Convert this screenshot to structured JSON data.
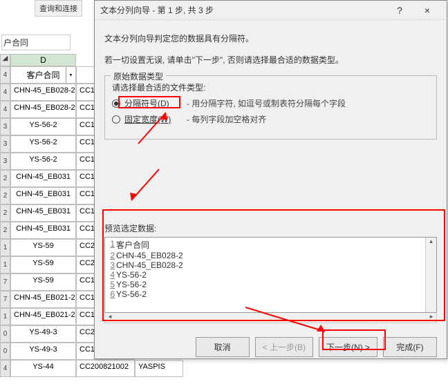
{
  "ribbon_group": "查询和连接",
  "cell_name_box": "户合同",
  "columns": {
    "D": "D"
  },
  "table_header": {
    "D": "客户合同"
  },
  "rows": [
    {
      "r": "4",
      "D": "CHN-45_EB028-2",
      "E": "CC1"
    },
    {
      "r": "4",
      "D": "CHN-45_EB028-2",
      "E": "CC1"
    },
    {
      "r": "3",
      "D": "YS-56-2",
      "E": "CC1"
    },
    {
      "r": "3",
      "D": "YS-56-2",
      "E": "CC1"
    },
    {
      "r": "3",
      "D": "YS-56-2",
      "E": "CC1"
    },
    {
      "r": "2",
      "D": "CHN-45_EB031",
      "E": "CC1"
    },
    {
      "r": "2",
      "D": "CHN-45_EB031",
      "E": "CC1"
    },
    {
      "r": "2",
      "D": "CHN-45_EB031",
      "E": "CC1"
    },
    {
      "r": "2",
      "D": "CHN-45_EB031",
      "E": "CC1"
    },
    {
      "r": "1",
      "D": "YS-59",
      "E": "CC2"
    },
    {
      "r": "1",
      "D": "YS-59",
      "E": "CC2"
    },
    {
      "r": "7",
      "D": "YS-59",
      "E": "CC1"
    },
    {
      "r": "7",
      "D": "CHN-45_EB021-2",
      "E": "CC1"
    },
    {
      "r": "1",
      "D": "CHN-45_EB021-2",
      "E": "CC1"
    },
    {
      "r": "0",
      "D": "YS-49-3",
      "E": "CC2"
    },
    {
      "r": "0",
      "D": "YS-49-3",
      "E": "CC1"
    },
    {
      "r": "4",
      "D": "YS-44",
      "E": "CC200821002",
      "F": "YASPIS"
    }
  ],
  "dialog": {
    "title": "文本分列向导 - 第 1 步, 共 3 步",
    "help": "?",
    "close": "×",
    "intro1": "文本分列向导判定您的数据具有分隔符。",
    "intro2": "若一切设置无误, 请单击\"下一步\", 否则请选择最合适的数据类型。",
    "section_title": "原始数据类型",
    "prompt": "请选择最合适的文件类型:",
    "opt_delim": "分隔符号(D)",
    "opt_delim_desc": "- 用分隔字符, 如逗号或制表符分隔每个字段",
    "opt_fixed": "固定宽度(W)",
    "opt_fixed_desc": "- 每列字段加空格对齐",
    "preview_label": "预览选定数据:",
    "preview_lines": [
      {
        "n": "1",
        "t": "客户合同"
      },
      {
        "n": "2",
        "t": "CHN-45_EB028-2"
      },
      {
        "n": "3",
        "t": "CHN-45_EB028-2"
      },
      {
        "n": "4",
        "t": "YS-56-2"
      },
      {
        "n": "5",
        "t": "YS-56-2"
      },
      {
        "n": "6",
        "t": "YS-56-2"
      }
    ],
    "btn_cancel": "取消",
    "btn_back": "< 上一步(B)",
    "btn_next": "下一步(N) >",
    "btn_finish": "完成(F)"
  }
}
